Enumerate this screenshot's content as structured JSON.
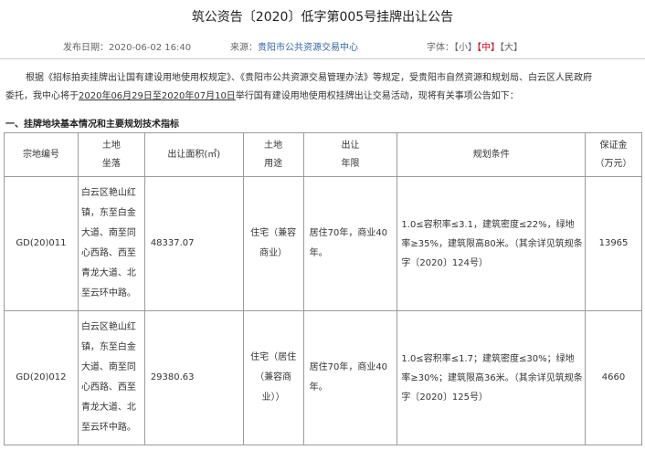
{
  "title": "筑公资告〔2020〕低字第005号挂牌出让公告",
  "meta": {
    "publish_date": "发布日期：2020-06-02 16:40",
    "source_label": "来源：",
    "source_value": "贵阳市公共资源交易中心",
    "font_label": "字体：",
    "font_small": "【小】",
    "font_medium": "【中】",
    "font_large": "【大】",
    "font_active": "medium"
  },
  "intro": {
    "line1": "根据《招标拍卖挂牌出让国有建设用地使用权规定》、《贵阳市公共资源交易管理办法》等规定，受贵阳市自然资源和规划局、白云区人民政府",
    "line2_prefix": "委托，我中心将于",
    "date_start": "2020年06月29日",
    "date_mid": "至",
    "date_end": "2020年07月10日",
    "line2_suffix": "举行国有建设用地使用权挂牌出让交易活动，现将有关事项公告如下："
  },
  "section1_heading": "一、挂牌地块基本情况和主要规划技术指标",
  "table": {
    "headers": {
      "parcel_no": "宗地编号",
      "location_l1": "土地",
      "location_l2": "坐落",
      "area": "出让面积(㎡)",
      "usage_l1": "土地",
      "usage_l2": "用途",
      "term_l1": "出让",
      "term_l2": "年限",
      "conditions": "规划条件",
      "deposit_l1": "保证金",
      "deposit_l2": "（万元）"
    },
    "rows": [
      {
        "parcel_no": "GD(20)011",
        "location": "白云区艳山红镇，东至白金大道、南至同心西路、西至青龙大道、北至云环中路。",
        "area": "48337.07",
        "usage": "住宅（兼容商业）",
        "term": "居住70年，商业40年。",
        "conditions": "1.0≤容积率≤3.1，建筑密度≤22%，绿地率≥35%，建筑限高80米。（其余详见筑规条字〔2020〕124号）",
        "deposit": "13965"
      },
      {
        "parcel_no": "GD(20)012",
        "location": "白云区艳山红镇，东至白金大道、南至同心西路、西至青龙大道、北至云环中路。",
        "area": "29380.63",
        "usage": "住宅（居住（兼容商业））",
        "term": "居住70年，商业40年。",
        "conditions": "1.0≤容积率≤1.7；建筑密度≤30%；绿地率≥30%；建筑限高36米。（其余详见筑规条字〔2020〕125号）",
        "deposit": "4660"
      }
    ]
  }
}
